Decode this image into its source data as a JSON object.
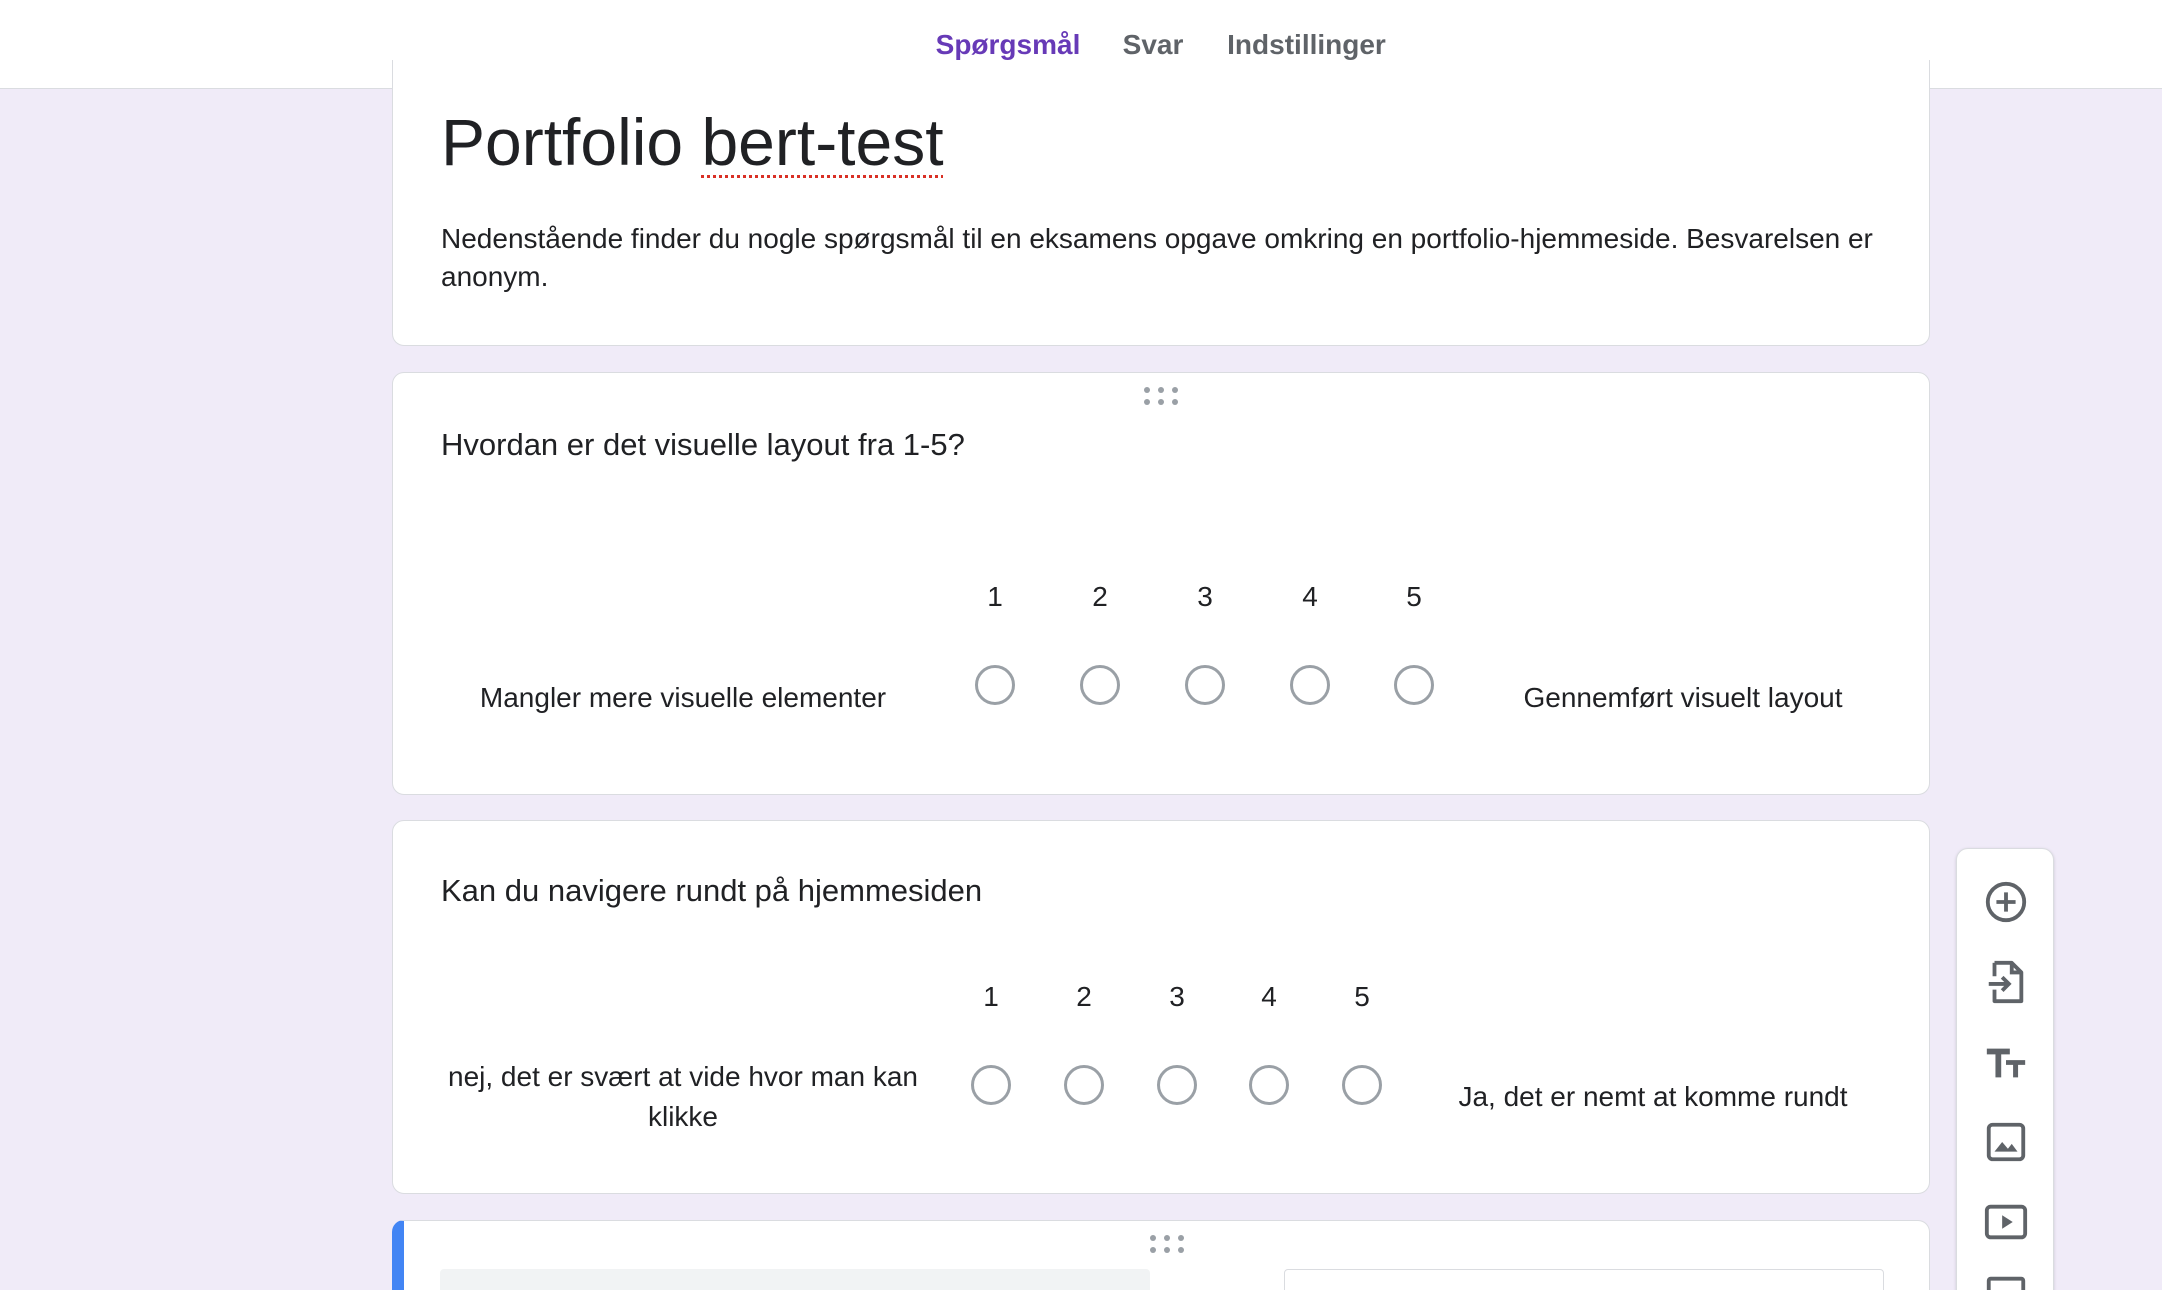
{
  "tabs": [
    {
      "label": "Spørgsmål",
      "active": true
    },
    {
      "label": "Svar",
      "active": false
    },
    {
      "label": "Indstillinger",
      "active": false
    }
  ],
  "form": {
    "title_part1": "Portfolio ",
    "title_part2": "bert-test",
    "description": "Nedenstående finder du nogle spørgsmål til en eksamens opgave omkring en portfolio-hjemmeside. Besvarelsen er anonym."
  },
  "questions": [
    {
      "title": "Hvordan er det visuelle layout fra 1-5?",
      "scale": [
        "1",
        "2",
        "3",
        "4",
        "5"
      ],
      "low_label": "Mangler mere visuelle elementer",
      "high_label": "Gennemført visuelt layout"
    },
    {
      "title": "Kan du navigere rundt på hjemmesiden",
      "scale": [
        "1",
        "2",
        "3",
        "4",
        "5"
      ],
      "low_label": "nej, det er svært at vide hvor man kan klikke",
      "high_label": "Ja, det er nemt at komme rundt"
    }
  ],
  "toolbar": {
    "icons": [
      "add-question-icon",
      "import-questions-icon",
      "add-title-icon",
      "add-image-icon",
      "add-video-icon",
      "add-section-icon"
    ]
  },
  "colors": {
    "accent": "#673ab7",
    "background": "#f0ebf8",
    "active_card": "#4285f4",
    "icon": "#5f6368"
  }
}
